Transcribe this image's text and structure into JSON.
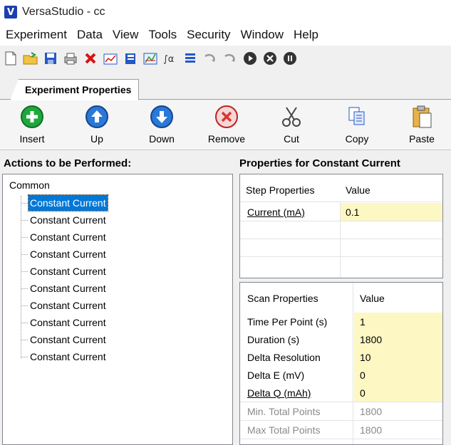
{
  "window": {
    "title": "VersaStudio - cc",
    "logo_letter": "V"
  },
  "menu": [
    "Experiment",
    "Data",
    "View",
    "Tools",
    "Security",
    "Window",
    "Help"
  ],
  "toolbar_icons": [
    "new-file-icon",
    "open-folder-icon",
    "save-icon",
    "print-icon",
    "delete-icon",
    "chart-icon",
    "notebook-icon",
    "graph-icon",
    "analysis-icon",
    "list-icon",
    "undo-icon",
    "redo-icon",
    "play-icon",
    "stop-icon",
    "pause-icon"
  ],
  "tab": {
    "label": "Experiment Properties"
  },
  "actions": [
    {
      "label": "Insert",
      "icon": "insert-icon"
    },
    {
      "label": "Up",
      "icon": "up-arrow-icon"
    },
    {
      "label": "Down",
      "icon": "down-arrow-icon"
    },
    {
      "label": "Remove",
      "icon": "remove-icon"
    },
    {
      "label": "Cut",
      "icon": "scissors-icon"
    },
    {
      "label": "Copy",
      "icon": "copy-icon"
    },
    {
      "label": "Paste",
      "icon": "paste-icon"
    }
  ],
  "left_panel": {
    "header": "Actions to be Performed:",
    "root": "Common",
    "items": [
      "Constant Current",
      "Constant Current",
      "Constant Current",
      "Constant Current",
      "Constant Current",
      "Constant Current",
      "Constant Current",
      "Constant Current",
      "Constant Current",
      "Constant Current"
    ],
    "selected_index": 0
  },
  "right_panel": {
    "header": "Properties for Constant Current",
    "step": {
      "col1": "Step Properties",
      "col2": "Value",
      "rows": [
        {
          "name": "Current (mA)",
          "value": "0.1"
        }
      ]
    },
    "scan": {
      "col1": "Scan Properties",
      "col2": "Value",
      "rows": [
        {
          "name": "Time Per Point (s)",
          "value": "1"
        },
        {
          "name": "Duration (s)",
          "value": "1800"
        },
        {
          "name": "Delta Resolution",
          "value": "10"
        },
        {
          "name": "Delta E (mV)",
          "value": "0"
        },
        {
          "name": "Delta Q (mAh)",
          "value": "0"
        },
        {
          "name": "Min. Total Points",
          "value": "1800"
        },
        {
          "name": "Max Total Points",
          "value": "1800"
        }
      ]
    }
  },
  "colors": {
    "selection": "#0078d7",
    "editable_cell": "#fdf7c3",
    "accent_green": "#1ea83c",
    "accent_blue": "#2a78d8",
    "accent_red": "#d33"
  }
}
